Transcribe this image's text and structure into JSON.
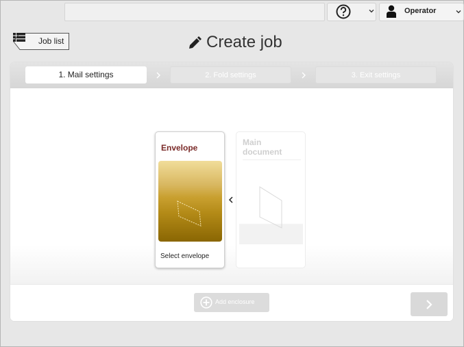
{
  "topbar": {
    "help_icon": "question-circle-icon",
    "user": {
      "label": "Operator",
      "icon": "user-icon"
    }
  },
  "header": {
    "job_list_label": "Job list",
    "job_list_icon": "grid-list-icon",
    "title": "Create job",
    "title_icon": "pen-icon"
  },
  "steps": [
    {
      "label": "1. Mail settings",
      "active": true
    },
    {
      "label": "2. Fold settings",
      "active": false
    },
    {
      "label": "3. Exit settings",
      "active": false
    }
  ],
  "cards": {
    "envelope": {
      "title": "Envelope",
      "action": "Select envelope"
    },
    "main_document": {
      "title": "Main document"
    }
  },
  "footer": {
    "add_enclosure_label": "Add enclosure",
    "add_enclosure_icon": "plus-circle-icon",
    "next_icon": "chevron-right-icon"
  },
  "colors": {
    "envelope_title": "#7a2a28",
    "envelope_gold": "#b38a17"
  }
}
